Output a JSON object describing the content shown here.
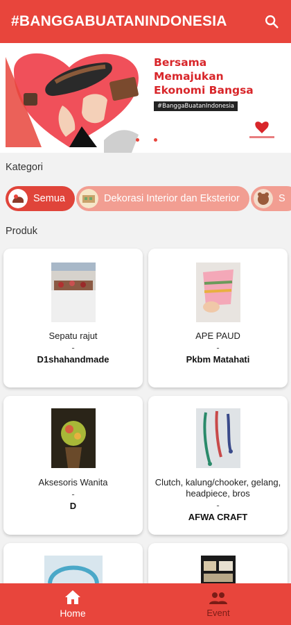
{
  "header": {
    "title": "#BANGGABUATANINDONESIA",
    "search_icon": "search-icon"
  },
  "banner": {
    "headline_1": "Bersama",
    "headline_2": "Memajukan",
    "headline_3": "Ekonomi Bangsa",
    "tag": "#BanggaBuatanIndonesia"
  },
  "kategori": {
    "label": "Kategori",
    "chips": [
      {
        "label": "Semua",
        "active": true
      },
      {
        "label": "Dekorasi Interior dan Eksterior",
        "active": false
      },
      {
        "label": "S",
        "active": false
      }
    ]
  },
  "produk": {
    "label": "Produk",
    "items": [
      {
        "name": "Sepatu rajut",
        "dash": "-",
        "shop": "D1shahandmade"
      },
      {
        "name": "APE PAUD",
        "dash": "-",
        "shop": "Pkbm Matahati"
      },
      {
        "name": "Aksesoris Wanita",
        "dash": "-",
        "shop": "D"
      },
      {
        "name": "Clutch, kalung/chooker, gelang, headpiece, bros",
        "dash": "-",
        "shop": "AFWA CRAFT"
      }
    ]
  },
  "bottom_nav": {
    "home": "Home",
    "event": "Event"
  },
  "colors": {
    "primary": "#e8453c",
    "chip_inactive": "#f29e92",
    "nav_inactive_text": "#7a1c16"
  }
}
